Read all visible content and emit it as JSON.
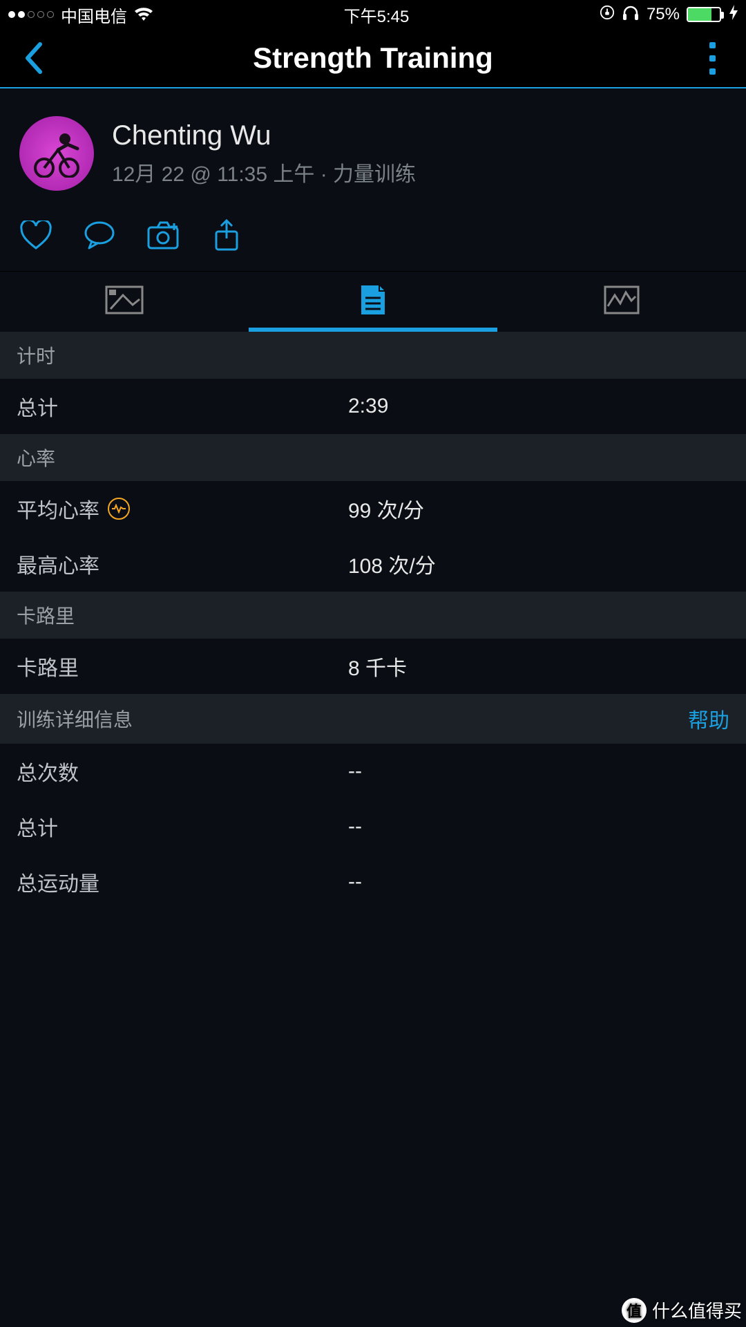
{
  "status": {
    "carrier": "中国电信",
    "time": "下午5:45",
    "battery_pct": "75%"
  },
  "header": {
    "title": "Strength Training"
  },
  "user": {
    "name": "Chenting Wu",
    "meta": "12月 22 @ 11:35 上午 · 力量训练"
  },
  "sections": {
    "timer": {
      "title": "计时"
    },
    "total_time": {
      "label": "总计",
      "value": "2:39"
    },
    "hr": {
      "title": "心率"
    },
    "avg_hr": {
      "label": "平均心率",
      "value": "99 次/分"
    },
    "max_hr": {
      "label": "最高心率",
      "value": "108 次/分"
    },
    "calories_section": {
      "title": "卡路里"
    },
    "calories": {
      "label": "卡路里",
      "value": "8 千卡"
    },
    "details": {
      "title": "训练详细信息",
      "help": "帮助"
    },
    "reps": {
      "label": "总次数",
      "value": "--"
    },
    "total2": {
      "label": "总计",
      "value": "--"
    },
    "volume": {
      "label": "总运动量",
      "value": "--"
    }
  },
  "watermark": "什么值得买",
  "watermark_badge": "值"
}
